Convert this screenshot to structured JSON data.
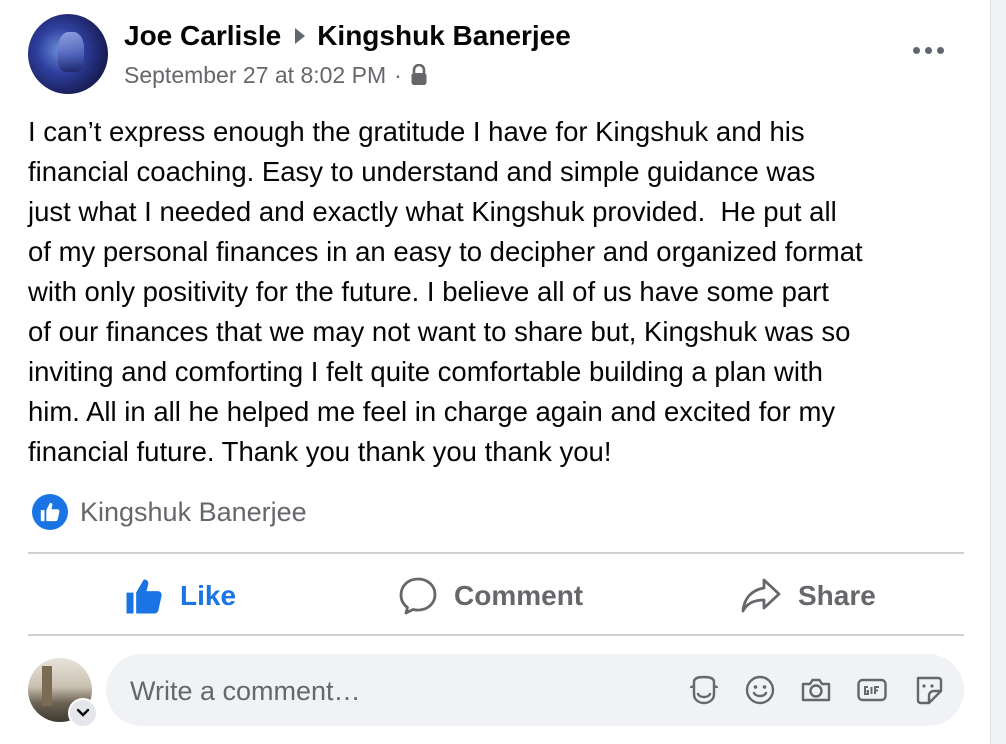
{
  "post": {
    "author": "Joe Carlisle",
    "recipient": "Kingshuk Banerjee",
    "timestamp": "September 27 at 8:02 PM",
    "separator": "·",
    "privacy_icon": "lock-icon",
    "text": "I can’t express enough the gratitude I have for Kingshuk and his\nfinancial coaching. Easy to understand and simple guidance was\njust what I needed and exactly what Kingshuk provided.  He put all\nof my personal finances in an easy to decipher and organized format\nwith only positivity for the future. I believe all of us have some part\nof our finances that we may not want to share but, Kingshuk was so\ninviting and comforting I felt quite comfortable building a plan with\nhim. All in all he helped me feel in charge again and excited for my\nfinancial future. Thank you thank you thank you!"
  },
  "reactions": {
    "icon": "like-reaction-icon",
    "names": "Kingshuk Banerjee"
  },
  "actions": {
    "like": "Like",
    "comment": "Comment",
    "share": "Share"
  },
  "composer": {
    "placeholder": "Write a comment…",
    "icons": [
      "avatar-sticker-icon",
      "emoji-icon",
      "camera-icon",
      "gif-icon",
      "sticker-icon"
    ]
  },
  "colors": {
    "accent": "#1b74e4",
    "secondary_text": "#65676b",
    "divider": "#ced0d4",
    "composer_bg": "#f0f2f5"
  }
}
